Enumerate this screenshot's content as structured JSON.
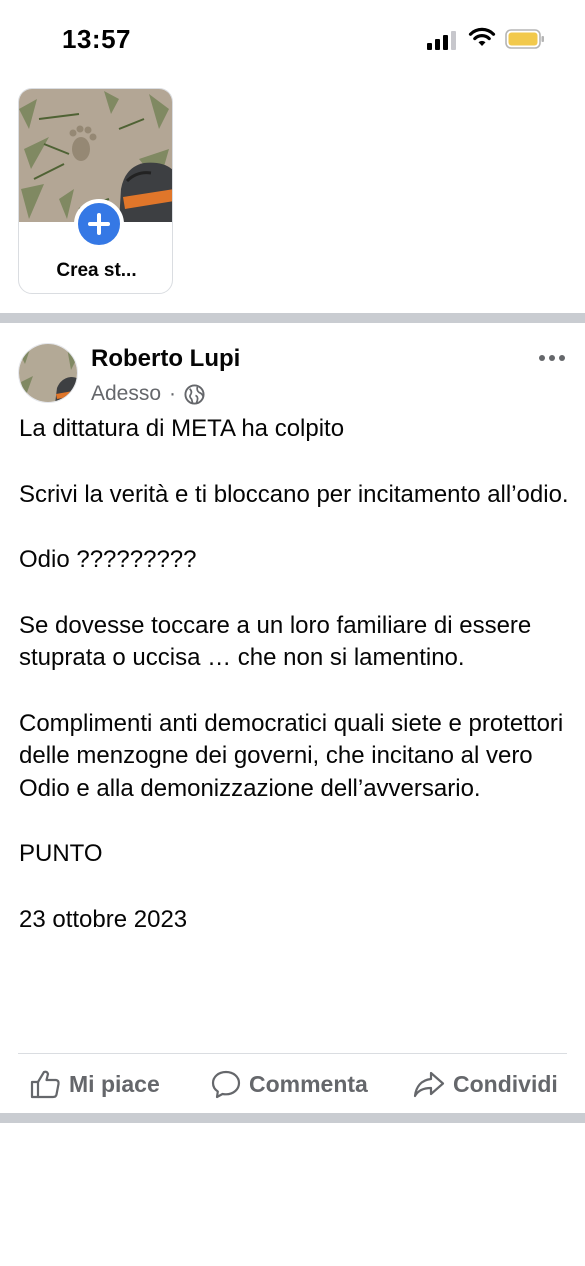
{
  "status_bar": {
    "time": "13:57",
    "icons": [
      "cellular-signal-icon",
      "wifi-icon",
      "battery-icon"
    ],
    "battery_color": "#f2c94c"
  },
  "stories": {
    "create_label": "Crea st...",
    "plus_icon": "plus-icon",
    "accent_color": "#3578e5"
  },
  "post": {
    "author": "Roberto Lupi",
    "time": "Adesso",
    "separator": "·",
    "privacy_icon": "globe-icon",
    "more_icon": "more-options-icon",
    "paragraphs": [
      "La dittatura di META ha colpito",
      "Scrivi la verità e ti bloccano per incitamento all’odio.",
      "Odio ?????????",
      "Se dovesse toccare a un loro familiare di essere stuprata o uccisa … che non si lamentino.",
      "Complimenti anti democratici quali siete e protettori delle menzogne dei governi, che incitano al vero Odio e alla demonizzazione dell’avversario.",
      "PUNTO",
      "23 ottobre 2023"
    ],
    "actions": {
      "like": "Mi piace",
      "comment": "Commenta",
      "share": "Condividi"
    }
  }
}
